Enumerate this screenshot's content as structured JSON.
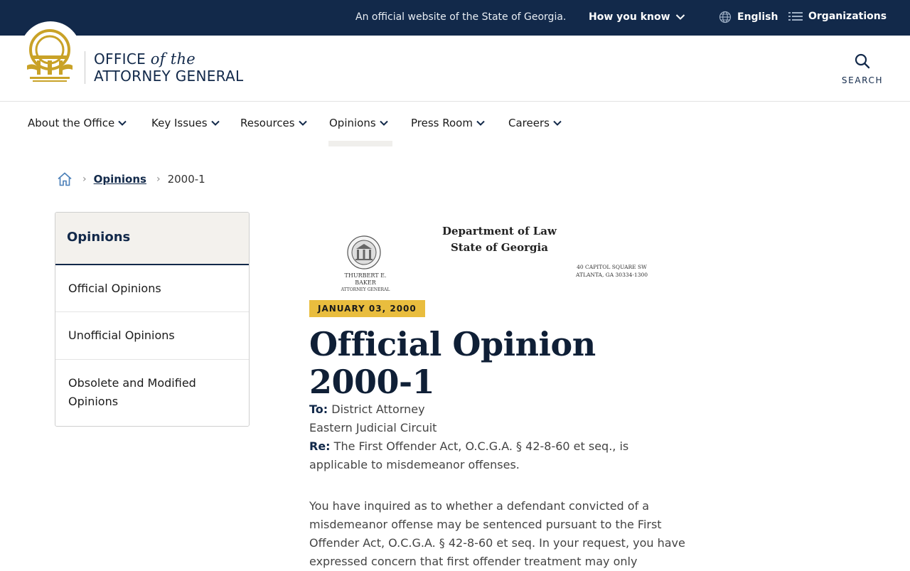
{
  "topbar": {
    "official_text": "An official website of the State of Georgia.",
    "how_you_know": "How you know",
    "language": "English",
    "organizations": "Organizations"
  },
  "header": {
    "logo_line1_a": "OFFICE ",
    "logo_line1_b": "of the",
    "logo_line2": "ATTORNEY GENERAL",
    "search_label": "SEARCH"
  },
  "nav": {
    "items": [
      {
        "label": "About the Office"
      },
      {
        "label": "Key Issues"
      },
      {
        "label": "Resources"
      },
      {
        "label": "Opinions"
      },
      {
        "label": "Press Room"
      },
      {
        "label": "Careers"
      }
    ],
    "active": "Opinions"
  },
  "breadcrumb": {
    "parent": "Opinions",
    "current": "2000-1"
  },
  "sidebar": {
    "heading": "Opinions",
    "links": [
      {
        "label": "Official Opinions"
      },
      {
        "label": "Unofficial Opinions"
      },
      {
        "label": "Obsolete and Modified Opinions"
      }
    ]
  },
  "letterhead": {
    "dept_line1": "Department of Law",
    "dept_line2": "State of Georgia",
    "ag_name": "THURBERT E. BAKER",
    "ag_title": "ATTORNEY GENERAL",
    "addr_line1": "40 CAPITOL SQUARE SW",
    "addr_line2": "ATLANTA, GA 30334-1300"
  },
  "article": {
    "date": "JANUARY 03, 2000",
    "title": "Official Opinion 2000-1",
    "to_label": "To:",
    "to_value": " District Attorney",
    "to_line2": "Eastern Judicial Circuit",
    "re_label": "Re:",
    "re_value": " The First Offender Act, O.C.G.A. § 42-8-60 et seq., is applicable to misdemeanor offenses.",
    "paragraph1": "You have inquired as to whether a defendant convicted of a misdemeanor offense may be sentenced pursuant to the First Offender Act, O.C.G.A. § 42-8-60 et seq. In your request, you have expressed concern that first offender treatment may only"
  },
  "colors": {
    "navy": "#12294a",
    "gold": "#e9bd3e",
    "seal_gold": "#c9a227"
  }
}
